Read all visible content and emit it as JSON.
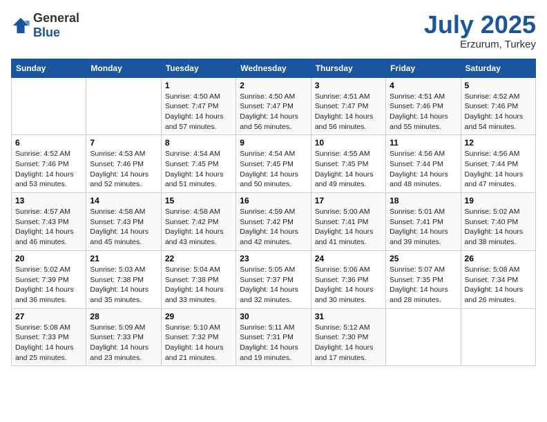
{
  "header": {
    "logo_general": "General",
    "logo_blue": "Blue",
    "month_year": "July 2025",
    "location": "Erzurum, Turkey"
  },
  "days_of_week": [
    "Sunday",
    "Monday",
    "Tuesday",
    "Wednesday",
    "Thursday",
    "Friday",
    "Saturday"
  ],
  "weeks": [
    [
      {
        "day": "",
        "sunrise": "",
        "sunset": "",
        "daylight": ""
      },
      {
        "day": "",
        "sunrise": "",
        "sunset": "",
        "daylight": ""
      },
      {
        "day": "1",
        "sunrise": "Sunrise: 4:50 AM",
        "sunset": "Sunset: 7:47 PM",
        "daylight": "Daylight: 14 hours and 57 minutes."
      },
      {
        "day": "2",
        "sunrise": "Sunrise: 4:50 AM",
        "sunset": "Sunset: 7:47 PM",
        "daylight": "Daylight: 14 hours and 56 minutes."
      },
      {
        "day": "3",
        "sunrise": "Sunrise: 4:51 AM",
        "sunset": "Sunset: 7:47 PM",
        "daylight": "Daylight: 14 hours and 56 minutes."
      },
      {
        "day": "4",
        "sunrise": "Sunrise: 4:51 AM",
        "sunset": "Sunset: 7:46 PM",
        "daylight": "Daylight: 14 hours and 55 minutes."
      },
      {
        "day": "5",
        "sunrise": "Sunrise: 4:52 AM",
        "sunset": "Sunset: 7:46 PM",
        "daylight": "Daylight: 14 hours and 54 minutes."
      }
    ],
    [
      {
        "day": "6",
        "sunrise": "Sunrise: 4:52 AM",
        "sunset": "Sunset: 7:46 PM",
        "daylight": "Daylight: 14 hours and 53 minutes."
      },
      {
        "day": "7",
        "sunrise": "Sunrise: 4:53 AM",
        "sunset": "Sunset: 7:46 PM",
        "daylight": "Daylight: 14 hours and 52 minutes."
      },
      {
        "day": "8",
        "sunrise": "Sunrise: 4:54 AM",
        "sunset": "Sunset: 7:45 PM",
        "daylight": "Daylight: 14 hours and 51 minutes."
      },
      {
        "day": "9",
        "sunrise": "Sunrise: 4:54 AM",
        "sunset": "Sunset: 7:45 PM",
        "daylight": "Daylight: 14 hours and 50 minutes."
      },
      {
        "day": "10",
        "sunrise": "Sunrise: 4:55 AM",
        "sunset": "Sunset: 7:45 PM",
        "daylight": "Daylight: 14 hours and 49 minutes."
      },
      {
        "day": "11",
        "sunrise": "Sunrise: 4:56 AM",
        "sunset": "Sunset: 7:44 PM",
        "daylight": "Daylight: 14 hours and 48 minutes."
      },
      {
        "day": "12",
        "sunrise": "Sunrise: 4:56 AM",
        "sunset": "Sunset: 7:44 PM",
        "daylight": "Daylight: 14 hours and 47 minutes."
      }
    ],
    [
      {
        "day": "13",
        "sunrise": "Sunrise: 4:57 AM",
        "sunset": "Sunset: 7:43 PM",
        "daylight": "Daylight: 14 hours and 46 minutes."
      },
      {
        "day": "14",
        "sunrise": "Sunrise: 4:58 AM",
        "sunset": "Sunset: 7:43 PM",
        "daylight": "Daylight: 14 hours and 45 minutes."
      },
      {
        "day": "15",
        "sunrise": "Sunrise: 4:58 AM",
        "sunset": "Sunset: 7:42 PM",
        "daylight": "Daylight: 14 hours and 43 minutes."
      },
      {
        "day": "16",
        "sunrise": "Sunrise: 4:59 AM",
        "sunset": "Sunset: 7:42 PM",
        "daylight": "Daylight: 14 hours and 42 minutes."
      },
      {
        "day": "17",
        "sunrise": "Sunrise: 5:00 AM",
        "sunset": "Sunset: 7:41 PM",
        "daylight": "Daylight: 14 hours and 41 minutes."
      },
      {
        "day": "18",
        "sunrise": "Sunrise: 5:01 AM",
        "sunset": "Sunset: 7:41 PM",
        "daylight": "Daylight: 14 hours and 39 minutes."
      },
      {
        "day": "19",
        "sunrise": "Sunrise: 5:02 AM",
        "sunset": "Sunset: 7:40 PM",
        "daylight": "Daylight: 14 hours and 38 minutes."
      }
    ],
    [
      {
        "day": "20",
        "sunrise": "Sunrise: 5:02 AM",
        "sunset": "Sunset: 7:39 PM",
        "daylight": "Daylight: 14 hours and 36 minutes."
      },
      {
        "day": "21",
        "sunrise": "Sunrise: 5:03 AM",
        "sunset": "Sunset: 7:38 PM",
        "daylight": "Daylight: 14 hours and 35 minutes."
      },
      {
        "day": "22",
        "sunrise": "Sunrise: 5:04 AM",
        "sunset": "Sunset: 7:38 PM",
        "daylight": "Daylight: 14 hours and 33 minutes."
      },
      {
        "day": "23",
        "sunrise": "Sunrise: 5:05 AM",
        "sunset": "Sunset: 7:37 PM",
        "daylight": "Daylight: 14 hours and 32 minutes."
      },
      {
        "day": "24",
        "sunrise": "Sunrise: 5:06 AM",
        "sunset": "Sunset: 7:36 PM",
        "daylight": "Daylight: 14 hours and 30 minutes."
      },
      {
        "day": "25",
        "sunrise": "Sunrise: 5:07 AM",
        "sunset": "Sunset: 7:35 PM",
        "daylight": "Daylight: 14 hours and 28 minutes."
      },
      {
        "day": "26",
        "sunrise": "Sunrise: 5:08 AM",
        "sunset": "Sunset: 7:34 PM",
        "daylight": "Daylight: 14 hours and 26 minutes."
      }
    ],
    [
      {
        "day": "27",
        "sunrise": "Sunrise: 5:08 AM",
        "sunset": "Sunset: 7:33 PM",
        "daylight": "Daylight: 14 hours and 25 minutes."
      },
      {
        "day": "28",
        "sunrise": "Sunrise: 5:09 AM",
        "sunset": "Sunset: 7:33 PM",
        "daylight": "Daylight: 14 hours and 23 minutes."
      },
      {
        "day": "29",
        "sunrise": "Sunrise: 5:10 AM",
        "sunset": "Sunset: 7:32 PM",
        "daylight": "Daylight: 14 hours and 21 minutes."
      },
      {
        "day": "30",
        "sunrise": "Sunrise: 5:11 AM",
        "sunset": "Sunset: 7:31 PM",
        "daylight": "Daylight: 14 hours and 19 minutes."
      },
      {
        "day": "31",
        "sunrise": "Sunrise: 5:12 AM",
        "sunset": "Sunset: 7:30 PM",
        "daylight": "Daylight: 14 hours and 17 minutes."
      },
      {
        "day": "",
        "sunrise": "",
        "sunset": "",
        "daylight": ""
      },
      {
        "day": "",
        "sunrise": "",
        "sunset": "",
        "daylight": ""
      }
    ]
  ]
}
